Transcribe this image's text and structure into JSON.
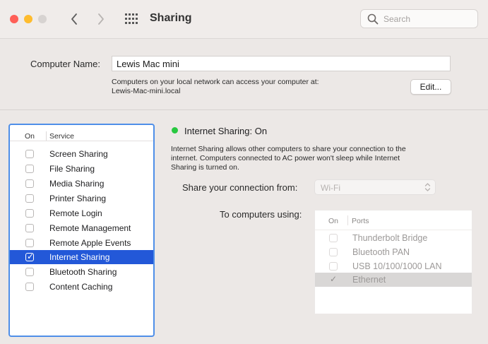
{
  "window": {
    "title": "Sharing",
    "search_placeholder": "Search"
  },
  "computer_name": {
    "label": "Computer Name:",
    "value": "Lewis Mac mini",
    "description_line1": "Computers on your local network can access your computer at:",
    "description_line2": "Lewis-Mac-mini.local",
    "edit_label": "Edit..."
  },
  "services": {
    "header_on": "On",
    "header_service": "Service",
    "items": [
      {
        "label": "Screen Sharing",
        "on": false,
        "selected": false
      },
      {
        "label": "File Sharing",
        "on": false,
        "selected": false
      },
      {
        "label": "Media Sharing",
        "on": false,
        "selected": false
      },
      {
        "label": "Printer Sharing",
        "on": false,
        "selected": false
      },
      {
        "label": "Remote Login",
        "on": false,
        "selected": false
      },
      {
        "label": "Remote Management",
        "on": false,
        "selected": false
      },
      {
        "label": "Remote Apple Events",
        "on": false,
        "selected": false
      },
      {
        "label": "Internet Sharing",
        "on": true,
        "selected": true
      },
      {
        "label": "Bluetooth Sharing",
        "on": false,
        "selected": false
      },
      {
        "label": "Content Caching",
        "on": false,
        "selected": false
      }
    ]
  },
  "detail": {
    "status_text": "Internet Sharing: On",
    "status_color": "#28c840",
    "description_line1": "Internet Sharing allows other computers to share your connection to the",
    "description_line2": "internet. Computers connected to AC power won't sleep while Internet",
    "description_line3": "Sharing is turned on.",
    "share_from_label": "Share your connection from:",
    "share_from_value": "Wi-Fi",
    "to_computers_label": "To computers using:",
    "ports_header_on": "On",
    "ports_header_ports": "Ports",
    "ports": [
      {
        "label": "Thunderbolt Bridge",
        "on": false
      },
      {
        "label": "Bluetooth PAN",
        "on": false
      },
      {
        "label": "USB 10/100/1000 LAN",
        "on": false
      },
      {
        "label": "Ethernet",
        "on": true
      }
    ]
  },
  "colors": {
    "selection": "#2358d8",
    "focus_ring": "#4f8fe8"
  }
}
